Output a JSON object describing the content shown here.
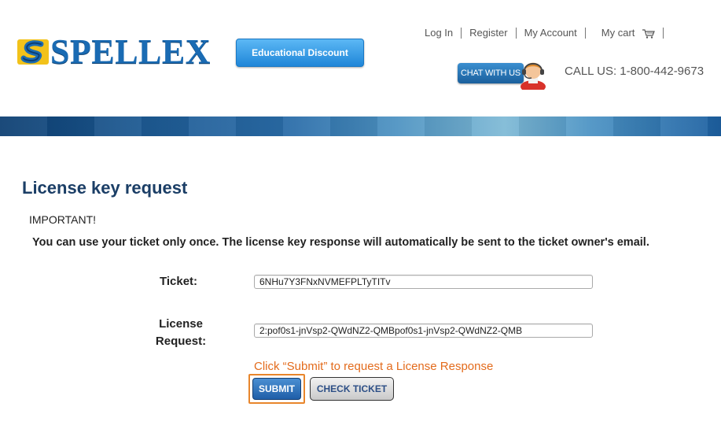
{
  "header": {
    "logo_text": "SPELLEX",
    "edu_button": "Educational Discount",
    "nav": [
      "Log In",
      "Register",
      "My Account",
      "My cart"
    ],
    "chat_label": "CHAT WITH US",
    "call_us": "CALL US: 1-800-442-9673"
  },
  "main": {
    "title": "License key request",
    "important": "IMPORTANT!",
    "notice": "You can use your ticket only once. The license key response will automatically be sent to the ticket owner's email.",
    "ticket_label": "Ticket:",
    "ticket_value": "6NHu7Y3FNxNVMEFPLTyTITv",
    "license_label_line1": "License",
    "license_label_line2": "Request:",
    "license_value": "2:pof0s1-jnVsp2-QWdNZ2-QMBpof0s1-jnVsp2-QWdNZ2-QMB",
    "hint": "Click “Submit” to request a License Response",
    "submit_label": "SUBMIT",
    "check_label": "CHECK TICKET"
  },
  "colors": {
    "brand_blue": "#1a6bb3",
    "title_navy": "#1b3e66",
    "hint_orange": "#e36b1c",
    "highlight_border": "#e8862c"
  },
  "icons": [
    "spellex-logo-icon",
    "cart-icon",
    "chat-agent-icon"
  ]
}
